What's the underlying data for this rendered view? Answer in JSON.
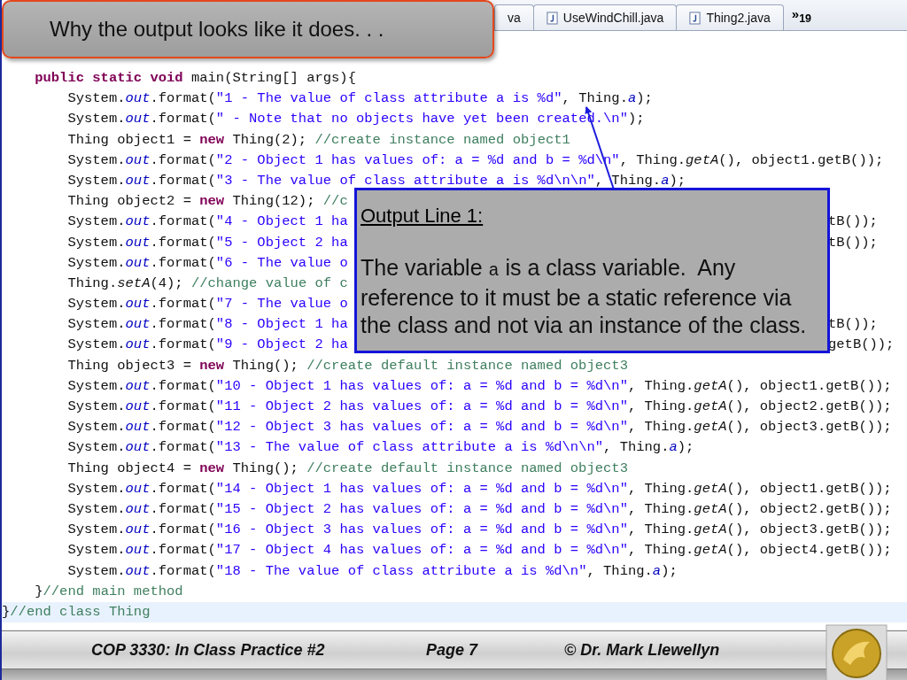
{
  "slide_title": "Why the output looks like it does. . .",
  "editor": {
    "tabs": [
      {
        "label": "va",
        "selected": false
      },
      {
        "label": "UseWindChill.java",
        "selected": false
      },
      {
        "label": "Thing2.java",
        "selected": false
      }
    ],
    "overflow": "»$_{19}$",
    "lines": [
      {
        "highlighted": false,
        "tokens": [
          {
            "kind": "kw",
            "text": "    public static void"
          },
          {
            "kind": "p",
            "text": " main(String[] args){"
          }
        ]
      },
      {
        "highlighted": false,
        "tokens": [
          {
            "kind": "p",
            "text": "        System."
          },
          {
            "kind": "field",
            "text": "out"
          },
          {
            "kind": "p",
            "text": ".format("
          },
          {
            "kind": "str",
            "text": "\"1 - The value of class attribute a is %d\""
          },
          {
            "kind": "p",
            "text": ", Thing."
          },
          {
            "kind": "field",
            "text": "a"
          },
          {
            "kind": "p",
            "text": ");"
          }
        ]
      },
      {
        "highlighted": false,
        "tokens": [
          {
            "kind": "p",
            "text": "        System."
          },
          {
            "kind": "field",
            "text": "out"
          },
          {
            "kind": "p",
            "text": ".format("
          },
          {
            "kind": "str",
            "text": "\" - Note that no objects have yet been created.\\n\""
          },
          {
            "kind": "p",
            "text": ");"
          }
        ]
      },
      {
        "highlighted": false,
        "tokens": [
          {
            "kind": "p",
            "text": "        Thing object1 = "
          },
          {
            "kind": "kw",
            "text": "new"
          },
          {
            "kind": "p",
            "text": " Thing(2); "
          },
          {
            "kind": "com",
            "text": "//create instance named object1"
          }
        ]
      },
      {
        "highlighted": false,
        "tokens": [
          {
            "kind": "p",
            "text": "        System."
          },
          {
            "kind": "field",
            "text": "out"
          },
          {
            "kind": "p",
            "text": ".format("
          },
          {
            "kind": "str",
            "text": "\"2 - Object 1 has values of: a = %d and b = %d\\n\""
          },
          {
            "kind": "p",
            "text": ", Thing."
          },
          {
            "kind": "method",
            "text": "getA"
          },
          {
            "kind": "p",
            "text": "(), object1.getB());"
          }
        ]
      },
      {
        "highlighted": false,
        "tokens": [
          {
            "kind": "p",
            "text": "        System."
          },
          {
            "kind": "field",
            "text": "out"
          },
          {
            "kind": "p",
            "text": ".format("
          },
          {
            "kind": "str",
            "text": "\"3 - The value of class attribute a is %d\\n\\n\""
          },
          {
            "kind": "p",
            "text": ", Thing."
          },
          {
            "kind": "field",
            "text": "a"
          },
          {
            "kind": "p",
            "text": ");"
          }
        ]
      },
      {
        "highlighted": false,
        "tokens": [
          {
            "kind": "p",
            "text": "        Thing object2 = "
          },
          {
            "kind": "kw",
            "text": "new"
          },
          {
            "kind": "p",
            "text": " Thing(12); "
          },
          {
            "kind": "com",
            "text": "//c"
          }
        ]
      },
      {
        "highlighted": false,
        "tokens": [
          {
            "kind": "p",
            "text": "        System."
          },
          {
            "kind": "field",
            "text": "out"
          },
          {
            "kind": "p",
            "text": ".format("
          },
          {
            "kind": "str",
            "text": "\"4 - Object 1 ha"
          }
        ],
        "tail": "tB());"
      },
      {
        "highlighted": false,
        "tokens": [
          {
            "kind": "p",
            "text": "        System."
          },
          {
            "kind": "field",
            "text": "out"
          },
          {
            "kind": "p",
            "text": ".format("
          },
          {
            "kind": "str",
            "text": "\"5 - Object 2 ha"
          }
        ],
        "tail": "tB());"
      },
      {
        "highlighted": false,
        "tokens": [
          {
            "kind": "p",
            "text": "        System."
          },
          {
            "kind": "field",
            "text": "out"
          },
          {
            "kind": "p",
            "text": ".format("
          },
          {
            "kind": "str",
            "text": "\"6 - The value o"
          }
        ]
      },
      {
        "highlighted": false,
        "tokens": [
          {
            "kind": "p",
            "text": "        Thing."
          },
          {
            "kind": "method",
            "text": "setA"
          },
          {
            "kind": "p",
            "text": "(4); "
          },
          {
            "kind": "com",
            "text": "//change value of c"
          }
        ]
      },
      {
        "highlighted": false,
        "tokens": [
          {
            "kind": "p",
            "text": "        System."
          },
          {
            "kind": "field",
            "text": "out"
          },
          {
            "kind": "p",
            "text": ".format("
          },
          {
            "kind": "str",
            "text": "\"7 - The value o"
          }
        ]
      },
      {
        "highlighted": false,
        "tokens": [
          {
            "kind": "p",
            "text": "        System."
          },
          {
            "kind": "field",
            "text": "out"
          },
          {
            "kind": "p",
            "text": ".format("
          },
          {
            "kind": "str",
            "text": "\"8 - Object 1 ha"
          }
        ],
        "tail": "tB());"
      },
      {
        "highlighted": false,
        "tokens": [
          {
            "kind": "p",
            "text": "        System."
          },
          {
            "kind": "field",
            "text": "out"
          },
          {
            "kind": "p",
            "text": ".format("
          },
          {
            "kind": "str",
            "text": "\"9 - Object 2 ha"
          }
        ],
        "tail": "getB());"
      },
      {
        "highlighted": false,
        "tokens": [
          {
            "kind": "p",
            "text": "        Thing object3 = "
          },
          {
            "kind": "kw",
            "text": "new"
          },
          {
            "kind": "p",
            "text": " Thing(); "
          },
          {
            "kind": "com",
            "text": "//create default instance named object3"
          }
        ]
      },
      {
        "highlighted": false,
        "tokens": [
          {
            "kind": "p",
            "text": "        System."
          },
          {
            "kind": "field",
            "text": "out"
          },
          {
            "kind": "p",
            "text": ".format("
          },
          {
            "kind": "str",
            "text": "\"10 - Object 1 has values of: a = %d and b = %d\\n\""
          },
          {
            "kind": "p",
            "text": ", Thing."
          },
          {
            "kind": "method",
            "text": "getA"
          },
          {
            "kind": "p",
            "text": "(), object1.getB());"
          }
        ]
      },
      {
        "highlighted": false,
        "tokens": [
          {
            "kind": "p",
            "text": "        System."
          },
          {
            "kind": "field",
            "text": "out"
          },
          {
            "kind": "p",
            "text": ".format("
          },
          {
            "kind": "str",
            "text": "\"11 - Object 2 has values of: a = %d and b = %d\\n\""
          },
          {
            "kind": "p",
            "text": ", Thing."
          },
          {
            "kind": "method",
            "text": "getA"
          },
          {
            "kind": "p",
            "text": "(), object2.getB());"
          }
        ]
      },
      {
        "highlighted": false,
        "tokens": [
          {
            "kind": "p",
            "text": "        System."
          },
          {
            "kind": "field",
            "text": "out"
          },
          {
            "kind": "p",
            "text": ".format("
          },
          {
            "kind": "str",
            "text": "\"12 - Object 3 has values of: a = %d and b = %d\\n\""
          },
          {
            "kind": "p",
            "text": ", Thing."
          },
          {
            "kind": "method",
            "text": "getA"
          },
          {
            "kind": "p",
            "text": "(), object3.getB());"
          }
        ]
      },
      {
        "highlighted": false,
        "tokens": [
          {
            "kind": "p",
            "text": "        System."
          },
          {
            "kind": "field",
            "text": "out"
          },
          {
            "kind": "p",
            "text": ".format("
          },
          {
            "kind": "str",
            "text": "\"13 - The value of class attribute a is %d\\n\\n\""
          },
          {
            "kind": "p",
            "text": ", Thing."
          },
          {
            "kind": "field",
            "text": "a"
          },
          {
            "kind": "p",
            "text": ");"
          }
        ]
      },
      {
        "highlighted": false,
        "tokens": [
          {
            "kind": "p",
            "text": "        Thing object4 = "
          },
          {
            "kind": "kw",
            "text": "new"
          },
          {
            "kind": "p",
            "text": " Thing(); "
          },
          {
            "kind": "com",
            "text": "//create default instance named object3"
          }
        ]
      },
      {
        "highlighted": false,
        "tokens": [
          {
            "kind": "p",
            "text": "        System."
          },
          {
            "kind": "field",
            "text": "out"
          },
          {
            "kind": "p",
            "text": ".format("
          },
          {
            "kind": "str",
            "text": "\"14 - Object 1 has values of: a = %d and b = %d\\n\""
          },
          {
            "kind": "p",
            "text": ", Thing."
          },
          {
            "kind": "method",
            "text": "getA"
          },
          {
            "kind": "p",
            "text": "(), object1.getB());"
          }
        ]
      },
      {
        "highlighted": false,
        "tokens": [
          {
            "kind": "p",
            "text": "        System."
          },
          {
            "kind": "field",
            "text": "out"
          },
          {
            "kind": "p",
            "text": ".format("
          },
          {
            "kind": "str",
            "text": "\"15 - Object 2 has values of: a = %d and b = %d\\n\""
          },
          {
            "kind": "p",
            "text": ", Thing."
          },
          {
            "kind": "method",
            "text": "getA"
          },
          {
            "kind": "p",
            "text": "(), object2.getB());"
          }
        ]
      },
      {
        "highlighted": false,
        "tokens": [
          {
            "kind": "p",
            "text": "        System."
          },
          {
            "kind": "field",
            "text": "out"
          },
          {
            "kind": "p",
            "text": ".format("
          },
          {
            "kind": "str",
            "text": "\"16 - Object 3 has values of: a = %d and b = %d\\n\""
          },
          {
            "kind": "p",
            "text": ", Thing."
          },
          {
            "kind": "method",
            "text": "getA"
          },
          {
            "kind": "p",
            "text": "(), object3.getB());"
          }
        ]
      },
      {
        "highlighted": false,
        "tokens": [
          {
            "kind": "p",
            "text": "        System."
          },
          {
            "kind": "field",
            "text": "out"
          },
          {
            "kind": "p",
            "text": ".format("
          },
          {
            "kind": "str",
            "text": "\"17 - Object 4 has values of: a = %d and b = %d\\n\""
          },
          {
            "kind": "p",
            "text": ", Thing."
          },
          {
            "kind": "method",
            "text": "getA"
          },
          {
            "kind": "p",
            "text": "(), object4.getB());"
          }
        ]
      },
      {
        "highlighted": false,
        "tokens": [
          {
            "kind": "p",
            "text": "        System."
          },
          {
            "kind": "field",
            "text": "out"
          },
          {
            "kind": "p",
            "text": ".format("
          },
          {
            "kind": "str",
            "text": "\"18 - The value of class attribute a is %d\\n\""
          },
          {
            "kind": "p",
            "text": ", Thing."
          },
          {
            "kind": "field",
            "text": "a"
          },
          {
            "kind": "p",
            "text": ");"
          }
        ]
      },
      {
        "highlighted": false,
        "tokens": [
          {
            "kind": "p",
            "text": "    }"
          },
          {
            "kind": "com",
            "text": "//end main method"
          }
        ]
      },
      {
        "highlighted": true,
        "tokens": [
          {
            "kind": "p",
            "text": "}"
          },
          {
            "kind": "com",
            "text": "//end class Thing"
          }
        ]
      }
    ]
  },
  "callout": {
    "heading": "Output Line 1:",
    "text_before": "The variable ",
    "code": "a",
    "text_after": " is a class variable.  Any reference to it must be a static reference via the class and not via an instance of the class."
  },
  "footer": {
    "course": "COP 3330:  In Class Practice #2",
    "page": "Page 7",
    "author": "© Dr. Mark Llewellyn"
  }
}
